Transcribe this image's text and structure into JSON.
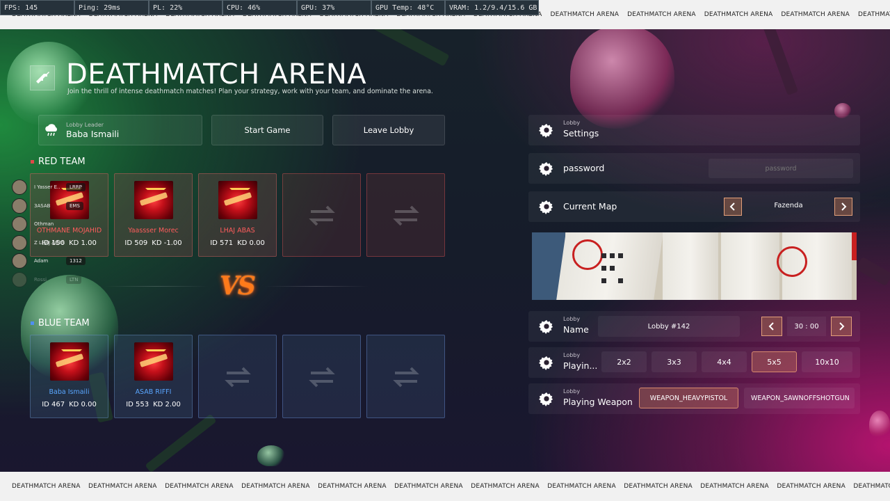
{
  "perf_bar": {
    "fps": "FPS: 145",
    "ping": "Ping: 29ms",
    "pl": "PL: 22%",
    "cpu": "CPU: 46%",
    "gpu": "GPU: 37%",
    "gpu_temp": "GPU Temp: 48°C",
    "vram": "VRAM: 1.2/9.4/15.6 GB"
  },
  "marquee": {
    "text": "DEATHMATCH ARENA"
  },
  "header": {
    "title": "DEATHMATCH ARENA",
    "subtitle": "Join the thrill of intense deathmatch matches! Plan your strategy, work with your team, and dominate the arena."
  },
  "leader": {
    "label": "Lobby Leader",
    "name": "Baba Ismaili"
  },
  "actions": {
    "start": "Start Game",
    "leave": "Leave Lobby"
  },
  "red_team": {
    "title": "RED TEAM",
    "players": [
      {
        "name": "OTHMANE MOJAHID",
        "id": "ID 150",
        "kd": "KD 1.00"
      },
      {
        "name": "Yaassser Morec",
        "id": "ID 509",
        "kd": "KD -1.00"
      },
      {
        "name": "LHAJ ABAS",
        "id": "ID 571",
        "kd": "KD 0.00"
      }
    ]
  },
  "blue_team": {
    "title": "BLUE TEAM",
    "players": [
      {
        "name": "Baba Ismaili",
        "id": "ID 467",
        "kd": "KD 0.00"
      },
      {
        "name": "ASAB RIFFI",
        "id": "ID 553",
        "kd": "KD 2.00"
      }
    ]
  },
  "vs_text": "VS",
  "voice_overlay": [
    {
      "name": "I Yasser E..",
      "tag": "LRRP"
    },
    {
      "name": "3ASAB",
      "tag": "EMS"
    },
    {
      "name": "Othman",
      "tag": ""
    },
    {
      "name": "Z LHAJ ABAS",
      "tag": ""
    },
    {
      "name": "Adam",
      "tag": "1312"
    },
    {
      "name": "Rossi",
      "tag": "LTN"
    }
  ],
  "settings": {
    "header_sub": "Lobby",
    "header_main": "Settings",
    "password_label": "password",
    "password_placeholder": "password",
    "map_label": "Current Map",
    "map_value": "Fazenda",
    "name_sub": "Lobby",
    "name_label": "Name",
    "lobby_name": "Lobby #142",
    "time_value": "30 : 00",
    "playing_sub": "Lobby",
    "playing_label": "Playin...",
    "modes": [
      "2x2",
      "3x3",
      "4x4",
      "5x5",
      "10x10"
    ],
    "selected_mode": "5x5",
    "weapon_sub": "Lobby",
    "weapon_label": "Playing Weapon",
    "weapons": [
      "WEAPON_HEAVYPISTOL",
      "WEAPON_SAWNOFFSHOTGUN"
    ]
  },
  "colors": {
    "accent": "#d98a6e",
    "red_marker": "#e04848",
    "blue_marker": "#4f8ff0",
    "red_name": "#ff5c5c",
    "blue_name": "#5aa6ff"
  }
}
